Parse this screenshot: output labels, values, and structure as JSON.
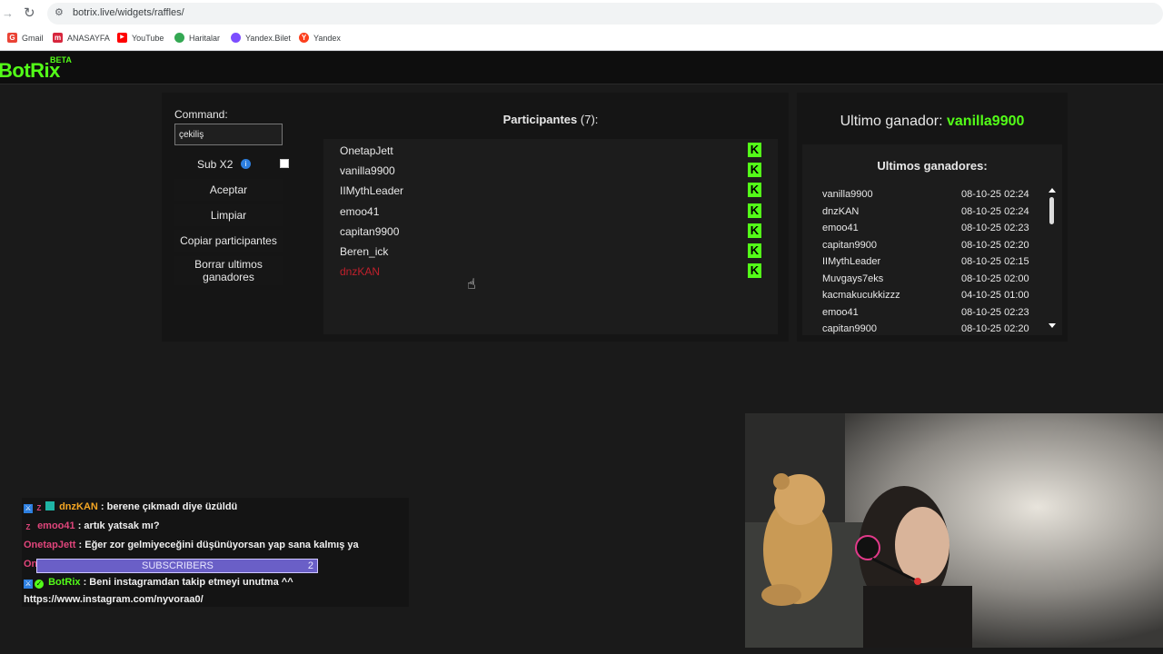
{
  "browser": {
    "url": "botrix.live/widgets/raffles/",
    "bookmarks": [
      {
        "label": "Gmail",
        "color": "#ea4335",
        "glyph": "G"
      },
      {
        "label": "ANASAYFA",
        "color": "#d7263d",
        "glyph": "m"
      },
      {
        "label": "YouTube",
        "color": "#ff0000",
        "glyph": "▶"
      },
      {
        "label": "Haritalar",
        "color": "#34a853",
        "glyph": "●"
      },
      {
        "label": "Yandex.Bilet",
        "color": "#7c4dff",
        "glyph": "●"
      },
      {
        "label": "Yandex",
        "color": "#fc3f1d",
        "glyph": "Y"
      }
    ]
  },
  "app": {
    "logo": "BotRix",
    "beta": "BETA",
    "accent": "#53fc18"
  },
  "controls": {
    "command_label": "Command:",
    "command_value": "çekiliş",
    "sub_label": "Sub X2",
    "sub_info_icon": "info-icon",
    "buttons": {
      "accept": "Aceptar",
      "clear": "Limpiar",
      "copy": "Copiar participantes",
      "delete_line1": "Borrar ultimos",
      "delete_line2": "ganadores"
    }
  },
  "participants": {
    "title": "Participantes",
    "count": "(7):",
    "items": [
      {
        "name": "OnetapJett"
      },
      {
        "name": "vanilla9900"
      },
      {
        "name": "IIMythLeader"
      },
      {
        "name": "emoo41"
      },
      {
        "name": "capitan9900"
      },
      {
        "name": "Beren_ick"
      },
      {
        "name": "dnzKAN"
      }
    ],
    "kick_glyph": "K"
  },
  "winners": {
    "last_label": "Ultimo ganador:",
    "last_name": "vanilla9900",
    "list_title": "Ultimos ganadores:",
    "items": [
      {
        "name": "vanilla9900",
        "date": "08-10-25 02:24"
      },
      {
        "name": "dnzKAN",
        "date": "08-10-25 02:24"
      },
      {
        "name": "emoo41",
        "date": "08-10-25 02:23"
      },
      {
        "name": "capitan9900",
        "date": "08-10-25 02:20"
      },
      {
        "name": "IIMythLeader",
        "date": "08-10-25 02:15"
      },
      {
        "name": "Muvgays7eks",
        "date": "08-10-25 02:00"
      },
      {
        "name": "kacmakucukkizzz",
        "date": "04-10-25 01:00"
      },
      {
        "name": "emoo41",
        "date": "08-10-25 02:23"
      },
      {
        "name": "capitan9900",
        "date": "08-10-25 02:20"
      }
    ]
  },
  "chat": {
    "messages": [
      {
        "user": "dnzKAN",
        "user_color": "#f5a623",
        "text": ": berene çıkmadı diye üzüldü"
      },
      {
        "user": "emoo41",
        "user_color": "#e0457b",
        "text": ": artık yatsak mı?"
      },
      {
        "user": "OnetapJett",
        "user_color": "#e0457b",
        "text": ": Eğer zor gelmiyeceğini düşünüyorsan yap sana kalmış ya"
      },
      {
        "user": "OnetapJett",
        "user_color": "#e0457b",
        "text": ":"
      },
      {
        "user": "BotRix",
        "user_color": "#53fc18",
        "text": ": Beni instagramdan takip etmeyi unutma ^^"
      }
    ],
    "link": "https://www.instagram.com/nyvoraa0/",
    "sub_banner": {
      "label": "SUBSCRIBERS",
      "value": "2"
    }
  }
}
